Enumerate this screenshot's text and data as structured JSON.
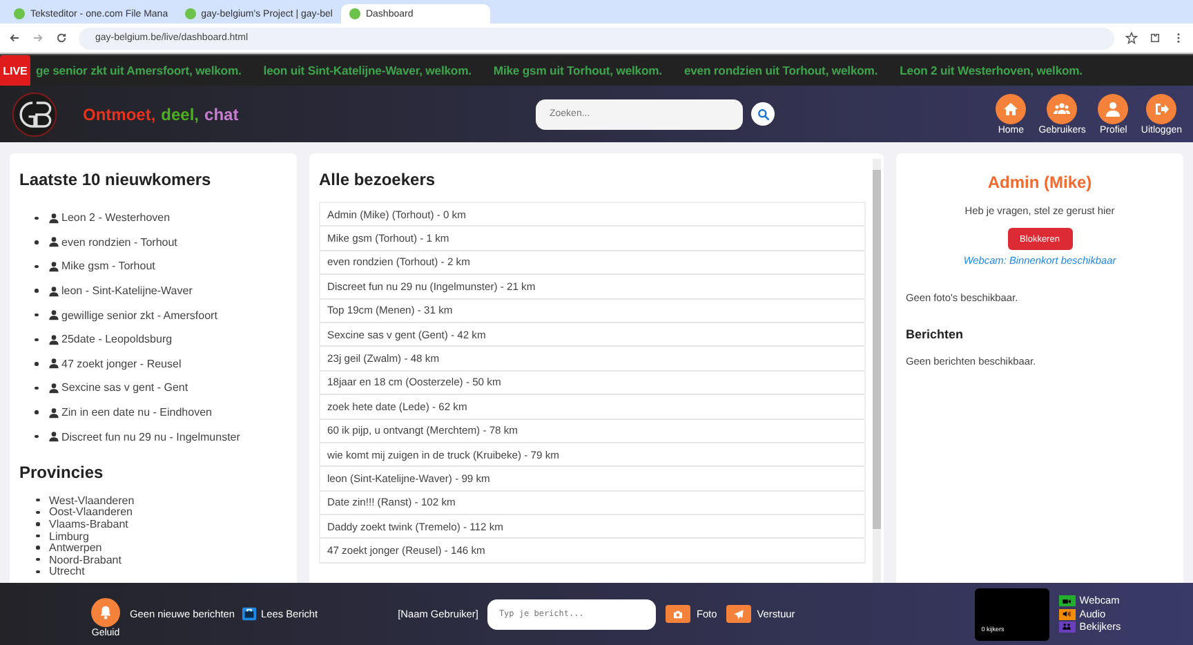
{
  "browser": {
    "tabs": [
      {
        "title": "Teksteditor - one.com File Mana",
        "selected": false
      },
      {
        "title": "gay-belgium's Project | gay-bel",
        "selected": false
      },
      {
        "title": "Dashboard",
        "selected": true
      }
    ],
    "address": "gay-belgium.be/live/dashboard.html"
  },
  "ticker": {
    "badge": "LIVE",
    "messages": [
      "ge senior zkt uit Amersfoort, welkom.",
      "leon uit Sint-Katelijne-Waver, welkom.",
      "Mike gsm uit Torhout, welkom.",
      "even rondzien uit Torhout, welkom.",
      "Leon 2 uit Westerhoven, welkom."
    ]
  },
  "header": {
    "slogan": [
      {
        "text": "Ontmoet,",
        "color": "#e8321e"
      },
      {
        "text": "deel,",
        "color": "#4caf1e"
      },
      {
        "text": "chat",
        "color": "#c77dd0"
      }
    ],
    "search": {
      "placeholder": "Zoeken..."
    },
    "nav": [
      {
        "label": "Home",
        "kind": "home"
      },
      {
        "label": "Gebruikers",
        "kind": "users"
      },
      {
        "label": "Profiel",
        "kind": "user"
      },
      {
        "label": "Uitloggen",
        "kind": "logout"
      }
    ]
  },
  "newcomers": {
    "title": "Laatste 10 nieuwkomers",
    "items": [
      "Leon 2 - Westerhoven",
      "even rondzien - Torhout",
      "Mike gsm - Torhout",
      "leon - Sint-Katelijne-Waver",
      "gewillige senior zkt - Amersfoort",
      "25date - Leopoldsburg",
      "47 zoekt jonger - Reusel",
      "Sexcine sas v gent - Gent",
      "Zin in een date nu - Eindhoven",
      "Discreet fun nu 29 nu - Ingelmunster"
    ]
  },
  "provinces": {
    "title": "Provincies",
    "items": [
      "West-Vlaanderen",
      "Oost-Vlaanderen",
      "Vlaams-Brabant",
      "Limburg",
      "Antwerpen",
      "Noord-Brabant",
      "Utrecht"
    ]
  },
  "visitors": {
    "title": "Alle bezoekers",
    "rows": [
      "Admin (Mike) (Torhout) - 0 km",
      "Mike gsm (Torhout) - 1 km",
      "even rondzien (Torhout) - 2 km",
      "Discreet fun nu 29 nu (Ingelmunster) - 21 km",
      "Top 19cm (Menen) - 31 km",
      "Sexcine sas v gent (Gent) - 42 km",
      "23j geil (Zwalm) - 48 km",
      "18jaar en 18 cm (Oosterzele) - 50 km",
      "zoek hete date (Lede) - 62 km",
      "60 ik pijp, u ontvangt (Merchtem) - 78 km",
      "wie komt mij zuigen in de truck (Kruibeke) - 79 km",
      "leon (Sint-Katelijne-Waver) - 99 km",
      "Date zin!!! (Ranst) - 102 km",
      "Daddy zoekt twink (Tremelo) - 112 km",
      "47 zoekt jonger (Reusel) - 146 km"
    ]
  },
  "profile": {
    "name": "Admin (Mike)",
    "subtitle": "Heb je vragen, stel ze gerust hier",
    "block_button": "Blokkeren",
    "webcam_link": "Webcam: Binnenkort beschikbaar",
    "photos_text": "Geen foto's beschikbaar.",
    "messages_title": "Berichten",
    "messages_text": "Geen berichten beschikbaar."
  },
  "footer": {
    "sound_label": "Geluid",
    "status": "Geen nieuwe berichten",
    "read_button": "Lees Bericht",
    "username": "[Naam Gebruiker]",
    "message_placeholder": "Typ je bericht...",
    "photo_button": "Foto",
    "send_button": "Verstuur",
    "viewer_count": "0 kijkers",
    "legend": [
      {
        "label": "Webcam",
        "kind": "video",
        "color": "#22b02c"
      },
      {
        "label": "Audio",
        "kind": "audio",
        "color": "#f28c00"
      },
      {
        "label": "Bekijkers",
        "kind": "viewers",
        "color": "#6a3fc0"
      }
    ]
  }
}
